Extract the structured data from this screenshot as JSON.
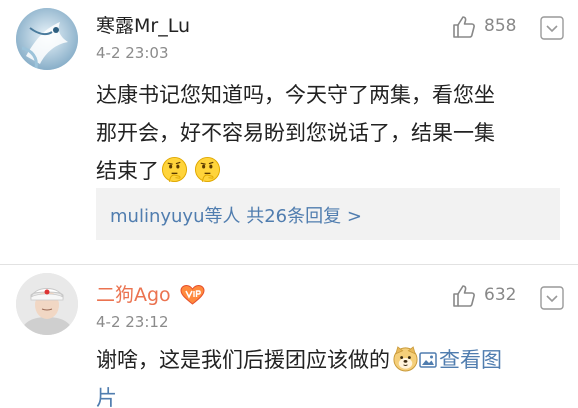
{
  "comments": [
    {
      "username": "寒露Mr_Lu",
      "time": "4-2 23:03",
      "likes": "858",
      "text_lines": [
        "达康书记您知道吗，今天守了两集，看您坐",
        "那开会，好不容易盼到您说话了，结果一集",
        "结束了"
      ],
      "emojis": [
        "thinking-emoji",
        "thinking-emoji"
      ],
      "replies": {
        "user": "mulinyuyu",
        "middle": "等人 ",
        "count_text": "共26条回复",
        "arrow": " >"
      }
    },
    {
      "username": "二狗Ago",
      "time": "4-2 23:12",
      "likes": "632",
      "text_lines": [
        "谢啥，这是我们后援团应该做的",
        "片"
      ],
      "emojis": [
        "doge-emoji"
      ],
      "view_picture": "查看图"
    }
  ],
  "colors": {
    "link_blue": "#507daf",
    "vip_orange": "#eb7350",
    "gray_text": "#8b8b8b",
    "reply_bg": "#f2f2f2"
  }
}
